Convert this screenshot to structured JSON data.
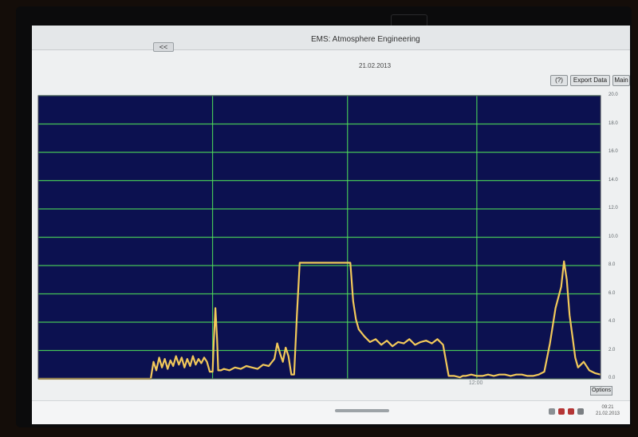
{
  "window": {
    "title": "EMS: Atmosphere Engineering",
    "nav_back_label": "<<",
    "date": "21.02.2013"
  },
  "toolbar": {
    "info_label": "(?)",
    "export_label": "Export Data",
    "main_label": "Main"
  },
  "chart_options_label": "Options",
  "taskbar": {
    "time": "09:21",
    "date": "21.02.2013"
  },
  "colors": {
    "plot_background": "#0c1150",
    "grid": "#4fe35a",
    "series": "#f2c95a"
  },
  "chart_data": {
    "type": "line",
    "title": "",
    "xlabel": "",
    "ylabel": "",
    "ylim": [
      0,
      20
    ],
    "yticks": [
      "20.0",
      "18.0",
      "16.0",
      "14.0",
      "12.0",
      "10.0",
      "8.0",
      "6.0",
      "4.0",
      "2.0",
      "0.0"
    ],
    "xticks": [
      {
        "label": "",
        "x": 0.31
      },
      {
        "label": "",
        "x": 0.55
      },
      {
        "label": "12:00",
        "x": 0.78
      }
    ],
    "x": [
      0,
      0.2,
      0.205,
      0.21,
      0.215,
      0.22,
      0.225,
      0.23,
      0.235,
      0.24,
      0.245,
      0.25,
      0.255,
      0.26,
      0.265,
      0.27,
      0.275,
      0.28,
      0.285,
      0.29,
      0.295,
      0.3,
      0.305,
      0.31,
      0.312,
      0.315,
      0.318,
      0.32,
      0.325,
      0.33,
      0.34,
      0.35,
      0.36,
      0.37,
      0.38,
      0.39,
      0.4,
      0.41,
      0.42,
      0.425,
      0.43,
      0.435,
      0.44,
      0.445,
      0.45,
      0.455,
      0.46,
      0.465,
      0.47,
      0.475,
      0.48,
      0.485,
      0.49,
      0.5,
      0.51,
      0.52,
      0.53,
      0.54,
      0.55,
      0.555,
      0.56,
      0.565,
      0.57,
      0.58,
      0.59,
      0.6,
      0.61,
      0.62,
      0.63,
      0.64,
      0.65,
      0.66,
      0.67,
      0.68,
      0.69,
      0.7,
      0.71,
      0.72,
      0.73,
      0.74,
      0.75,
      0.755,
      0.76,
      0.77,
      0.78,
      0.79,
      0.8,
      0.81,
      0.82,
      0.83,
      0.84,
      0.85,
      0.86,
      0.87,
      0.88,
      0.89,
      0.9,
      0.91,
      0.92,
      0.93,
      0.935,
      0.94,
      0.945,
      0.95,
      0.955,
      0.96,
      0.97,
      0.98,
      0.99,
      1.0
    ],
    "y": [
      0,
      0,
      1.2,
      0.6,
      1.5,
      0.8,
      1.4,
      0.7,
      1.3,
      0.9,
      1.6,
      1.0,
      1.5,
      0.8,
      1.4,
      0.9,
      1.6,
      1.0,
      1.4,
      1.1,
      1.5,
      1.2,
      0.5,
      0.5,
      2.5,
      5.0,
      2.8,
      0.6,
      0.6,
      0.7,
      0.6,
      0.8,
      0.7,
      0.9,
      0.8,
      0.7,
      1.0,
      0.9,
      1.4,
      2.5,
      1.8,
      1.2,
      2.2,
      1.6,
      0.3,
      0.3,
      4.5,
      8.2,
      8.2,
      8.2,
      8.2,
      8.2,
      8.2,
      8.2,
      8.2,
      8.2,
      8.2,
      8.2,
      8.2,
      8.2,
      5.5,
      4.2,
      3.5,
      3.0,
      2.6,
      2.8,
      2.4,
      2.7,
      2.3,
      2.6,
      2.5,
      2.8,
      2.4,
      2.6,
      2.7,
      2.5,
      2.8,
      2.4,
      0.2,
      0.2,
      0.1,
      0.2,
      0.2,
      0.3,
      0.2,
      0.2,
      0.3,
      0.2,
      0.3,
      0.3,
      0.2,
      0.3,
      0.3,
      0.2,
      0.2,
      0.3,
      0.5,
      2.5,
      5.0,
      6.5,
      8.3,
      7.0,
      4.5,
      3.0,
      1.5,
      0.8,
      1.2,
      0.6,
      0.4,
      0.3
    ]
  }
}
